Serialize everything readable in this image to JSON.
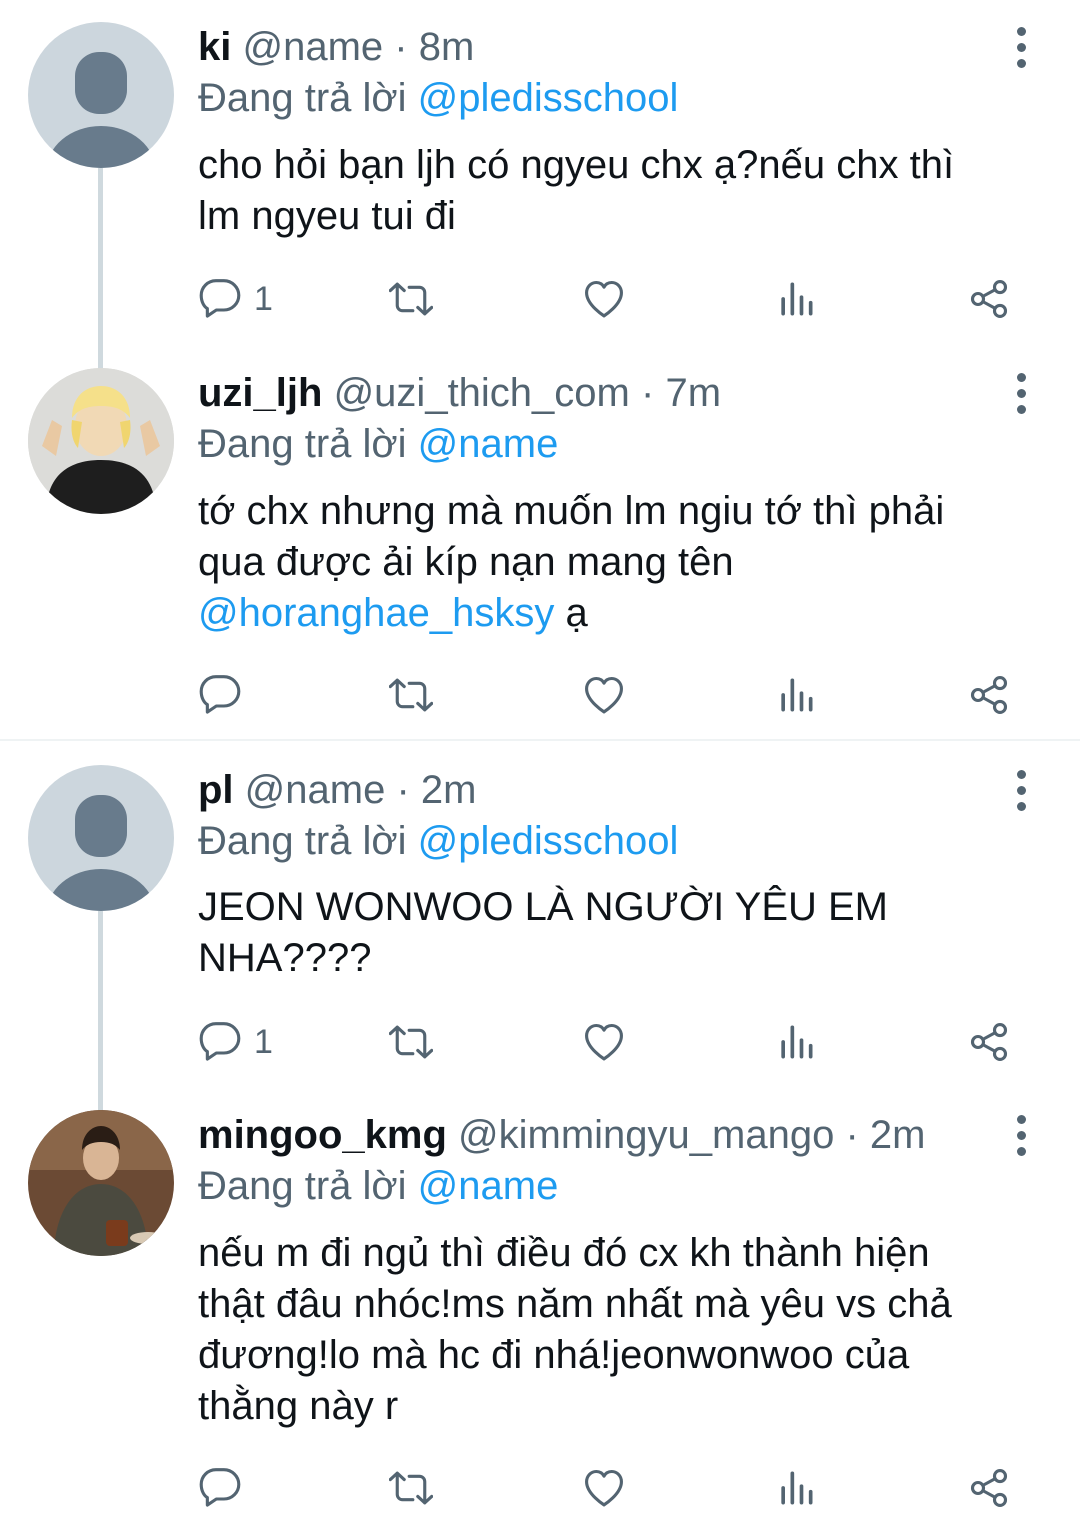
{
  "replying_label": "Đang trả lời",
  "tweets": [
    {
      "name": "ki",
      "handle": "@name",
      "time": "8m",
      "reply_to": "@pledisschool",
      "body_lines": [
        "cho hỏi bạn ljh có ngyeu chx ạ?nếu chx thì",
        "lm ngyeu tui đi"
      ],
      "reply_count": "1"
    },
    {
      "name": "uzi_ljh",
      "handle": "@uzi_thich_com",
      "time": "7m",
      "reply_to": "@name",
      "body_lines": [
        "tớ chx nhưng mà muốn lm ngiu tớ thì phải",
        "qua được ải kíp nạn mang tên"
      ],
      "body_mention": "@horanghae_hsksy",
      "body_tail": " ạ",
      "reply_count": ""
    },
    {
      "name": "pl",
      "handle": "@name",
      "time": "2m",
      "reply_to": "@pledisschool",
      "body_lines": [
        "JEON WONWOO LÀ NGƯỜI YÊU EM",
        "NHA????"
      ],
      "reply_count": "1"
    },
    {
      "name": "mingoo_kmg",
      "handle": "@kimmingyu_mango",
      "time": "2m",
      "reply_to": "@name",
      "body_lines": [
        "nếu m đi ngủ thì điều đó cx kh thành hiện",
        "thật đâu nhóc!ms năm nhất mà yêu vs chả",
        "đương!lo mà hc đi nhá!jeonwonwoo của",
        "thằng này r"
      ],
      "reply_count": ""
    }
  ],
  "colors": {
    "accent": "#1d9bf0",
    "secondary_text": "#536471",
    "thread_line": "#cfd9de"
  },
  "icons": [
    "reply-icon",
    "retweet-icon",
    "like-icon",
    "analytics-icon",
    "share-icon",
    "more-icon"
  ]
}
